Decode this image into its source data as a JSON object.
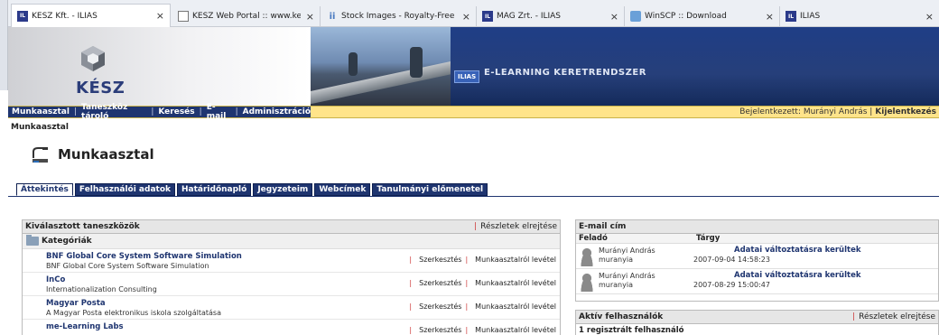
{
  "browser": {
    "tabs": [
      {
        "title": "KÉSZ Kft. - ILIAS",
        "favicon": "ilias-icon",
        "active": true
      },
      {
        "title": "KÉSZ Web Portal :: www.kesz.hu",
        "favicon": "page-icon",
        "active": false
      },
      {
        "title": "Stock Images - Royalty-Free Stock...",
        "favicon": "stock-icon",
        "active": false
      },
      {
        "title": "MAG Zrt. - ILIAS",
        "favicon": "ilias-icon",
        "active": false
      },
      {
        "title": "WinSCP :: Download",
        "favicon": "winscp-icon",
        "active": false
      },
      {
        "title": "ILIAS",
        "favicon": "ilias-icon",
        "active": false
      }
    ],
    "close_glyph": "×"
  },
  "header": {
    "logo_text": "KÉSZ",
    "ilias_badge": "ILIAS",
    "banner_title": "E-LEARNING KERETRENDSZER"
  },
  "nav": {
    "items": [
      "Munkaasztal",
      "Taneszköz tároló",
      "Keresés",
      "E-mail",
      "Adminisztráció"
    ],
    "logged_in_label": "Bejelentkezett: Murányi András |",
    "logout": "Kijelentkezés"
  },
  "breadcrumb": "Munkaasztal",
  "page_title": "Munkaasztal",
  "tabs": [
    "Áttekintés",
    "Felhasználói adatok",
    "Határidőnapló",
    "Jegyzeteim",
    "Webcímek",
    "Tanulmányi előmenetel"
  ],
  "selected_items": {
    "title": "Kiválasztott taneszközök",
    "hide_details": "Részletek elrejtése",
    "category": "Kategóriák",
    "edit": "Szerkesztés",
    "remove": "Munkaasztalról levétel",
    "items": [
      {
        "title": "BNF Global Core System Software Simulation",
        "desc": "BNF Global Core System Software Simulation"
      },
      {
        "title": "InCo",
        "desc": "Internationalization Consulting"
      },
      {
        "title": "Magyar Posta",
        "desc": "A Magyar Posta elektronikus iskola szolgáltatása"
      },
      {
        "title": "me-Learning Labs",
        "desc": ""
      }
    ]
  },
  "mail": {
    "title": "E-mail cím",
    "col_sender": "Feladó",
    "col_subject": "Tárgy",
    "rows": [
      {
        "name": "Murányi András",
        "login": "muranyia",
        "subject": "Adatai változtatásra kerültek",
        "date": "2007-09-04 14:58:23"
      },
      {
        "name": "Murányi András",
        "login": "muranyia",
        "subject": "Adatai változtatásra kerültek",
        "date": "2007-08-29 15:00:47"
      }
    ]
  },
  "active_users": {
    "title": "Aktív felhasználók",
    "hide_details": "Részletek elrejtése",
    "count": "1 regisztrált felhasználó"
  }
}
